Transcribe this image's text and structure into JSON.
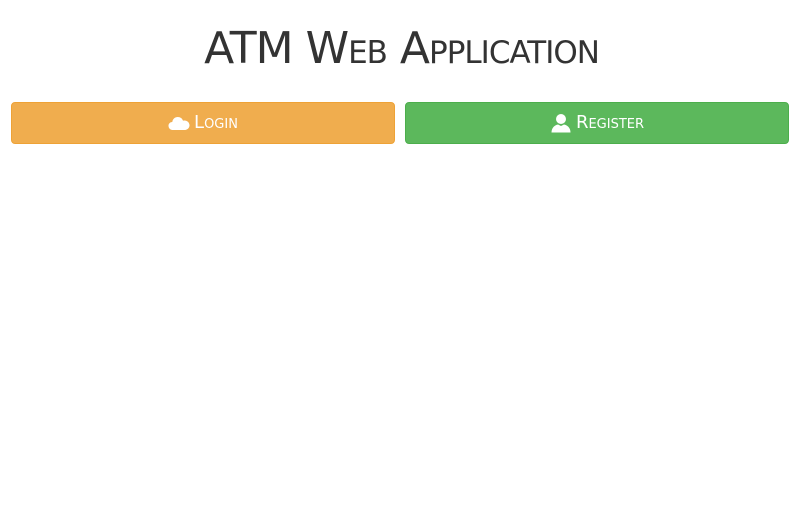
{
  "header": {
    "title": "ATM Web Application"
  },
  "actions": {
    "login": {
      "label": "Login",
      "icon": "cloud-icon",
      "color": "#f0ad4e"
    },
    "register": {
      "label": "Register",
      "icon": "user-icon",
      "color": "#5cb85c"
    }
  }
}
